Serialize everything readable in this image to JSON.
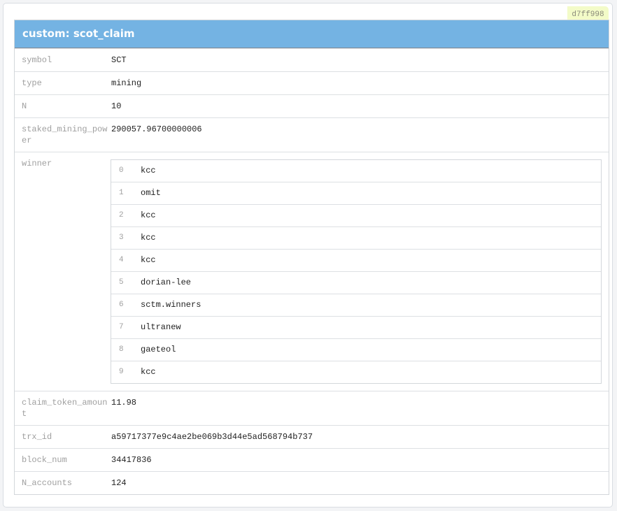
{
  "badge": "d7ff998",
  "title": "custom: scot_claim",
  "fields": {
    "symbol": {
      "key": "symbol",
      "value": "SCT"
    },
    "type": {
      "key": "type",
      "value": "mining"
    },
    "N": {
      "key": "N",
      "value": "10"
    },
    "staked": {
      "key": "staked_mining_power",
      "value": "290057.96700000006"
    },
    "winner": {
      "key": "winner",
      "items": [
        "kcc",
        "omit",
        "kcc",
        "kcc",
        "kcc",
        "dorian-lee",
        "sctm.winners",
        "ultranew",
        "gaeteol",
        "kcc"
      ],
      "indices": [
        "0",
        "1",
        "2",
        "3",
        "4",
        "5",
        "6",
        "7",
        "8",
        "9"
      ]
    },
    "claim": {
      "key": "claim_token_amount",
      "value": "11.98"
    },
    "trx": {
      "key": "trx_id",
      "value": "a59717377e9c4ae2be069b3d44e5ad568794b737"
    },
    "block": {
      "key": "block_num",
      "value": "34417836"
    },
    "accounts": {
      "key": "N_accounts",
      "value": "124"
    }
  }
}
